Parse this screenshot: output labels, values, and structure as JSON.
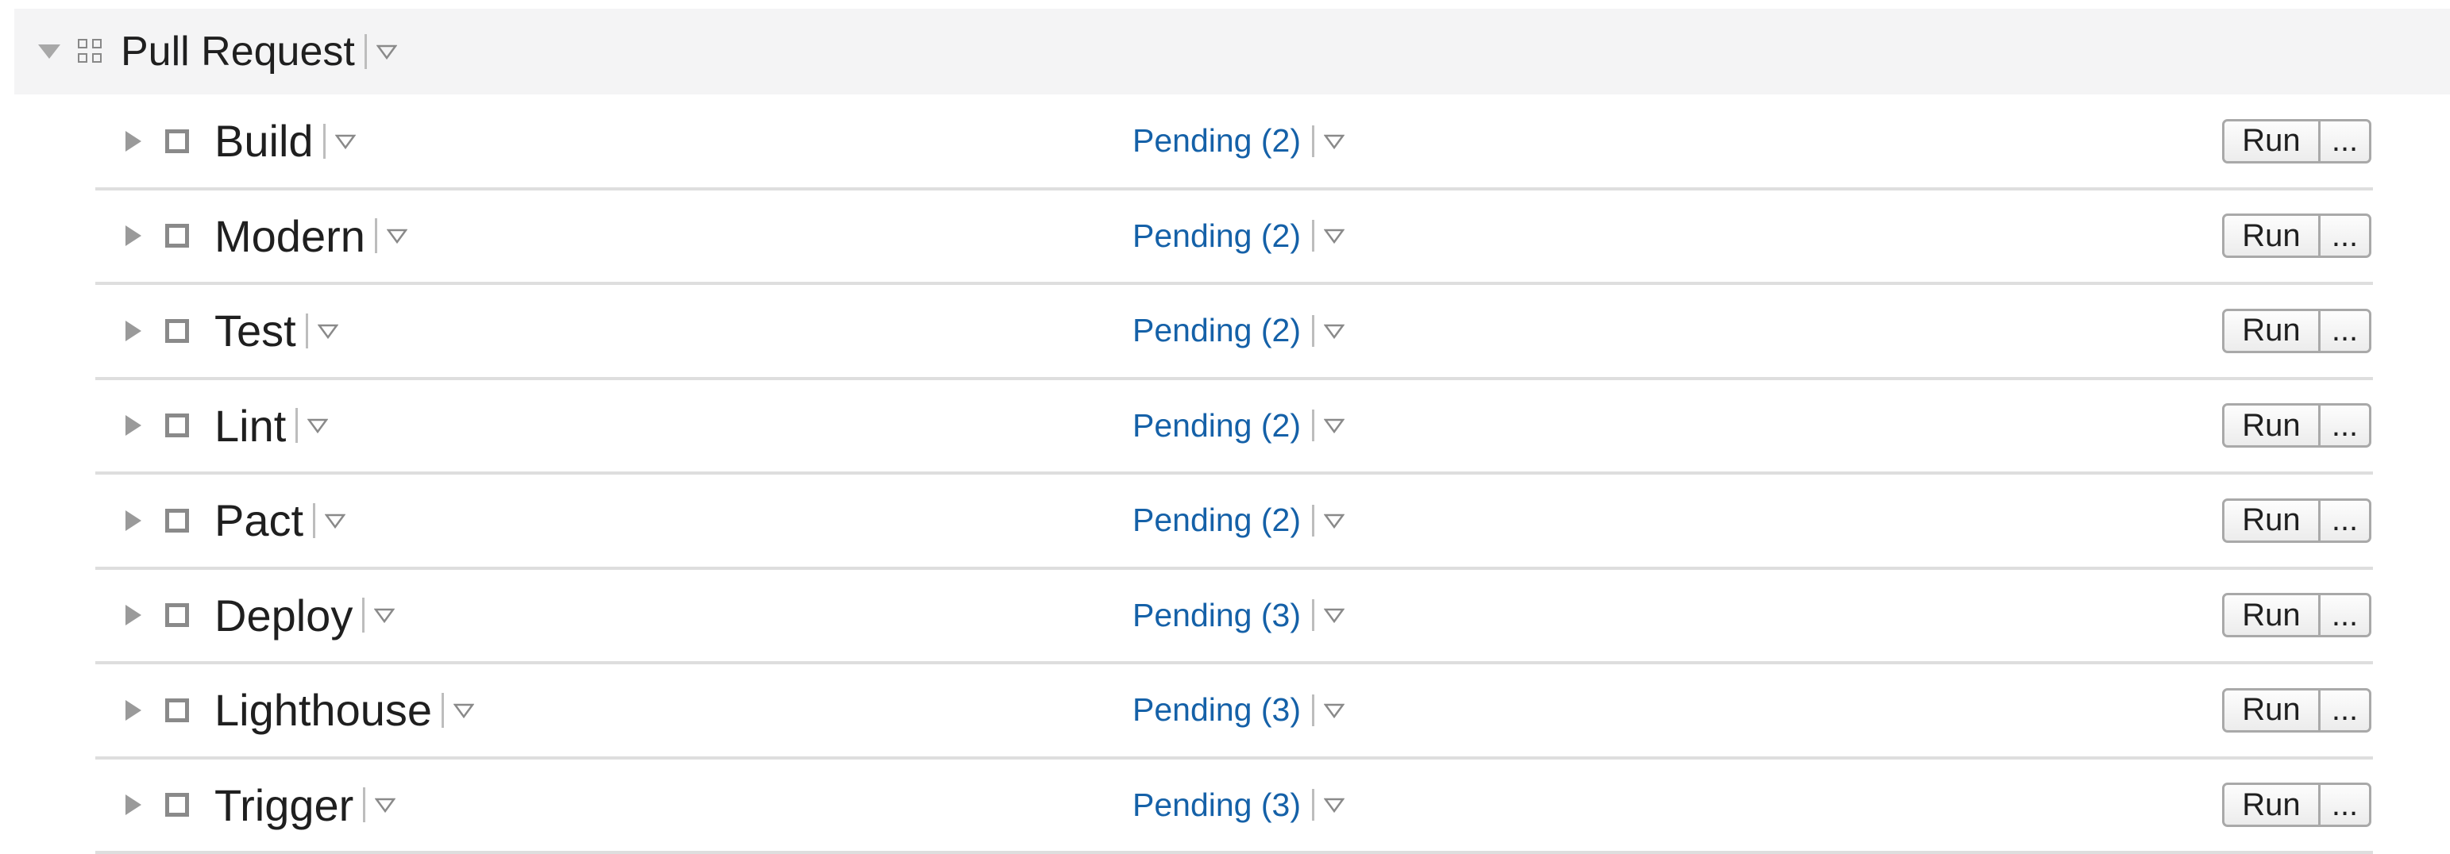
{
  "group": {
    "title": "Pull Request",
    "toggle_icon": "caret-down-icon",
    "icon": "grid-icon",
    "menu_icon": "dropdown-triangle-icon"
  },
  "colors": {
    "status_link": "#1561a8",
    "header_bg": "#f4f4f5",
    "divider": "#dedede"
  },
  "rows": [
    {
      "name": "Build",
      "status": "Pending (2)",
      "run_label": "Run",
      "more_label": "..."
    },
    {
      "name": "Modern",
      "status": "Pending (2)",
      "run_label": "Run",
      "more_label": "..."
    },
    {
      "name": "Test",
      "status": "Pending (2)",
      "run_label": "Run",
      "more_label": "..."
    },
    {
      "name": "Lint",
      "status": "Pending (2)",
      "run_label": "Run",
      "more_label": "..."
    },
    {
      "name": "Pact",
      "status": "Pending (2)",
      "run_label": "Run",
      "more_label": "..."
    },
    {
      "name": "Deploy",
      "status": "Pending (3)",
      "run_label": "Run",
      "more_label": "..."
    },
    {
      "name": "Lighthouse",
      "status": "Pending (3)",
      "run_label": "Run",
      "more_label": "..."
    },
    {
      "name": "Trigger",
      "status": "Pending (3)",
      "run_label": "Run",
      "more_label": "..."
    }
  ]
}
